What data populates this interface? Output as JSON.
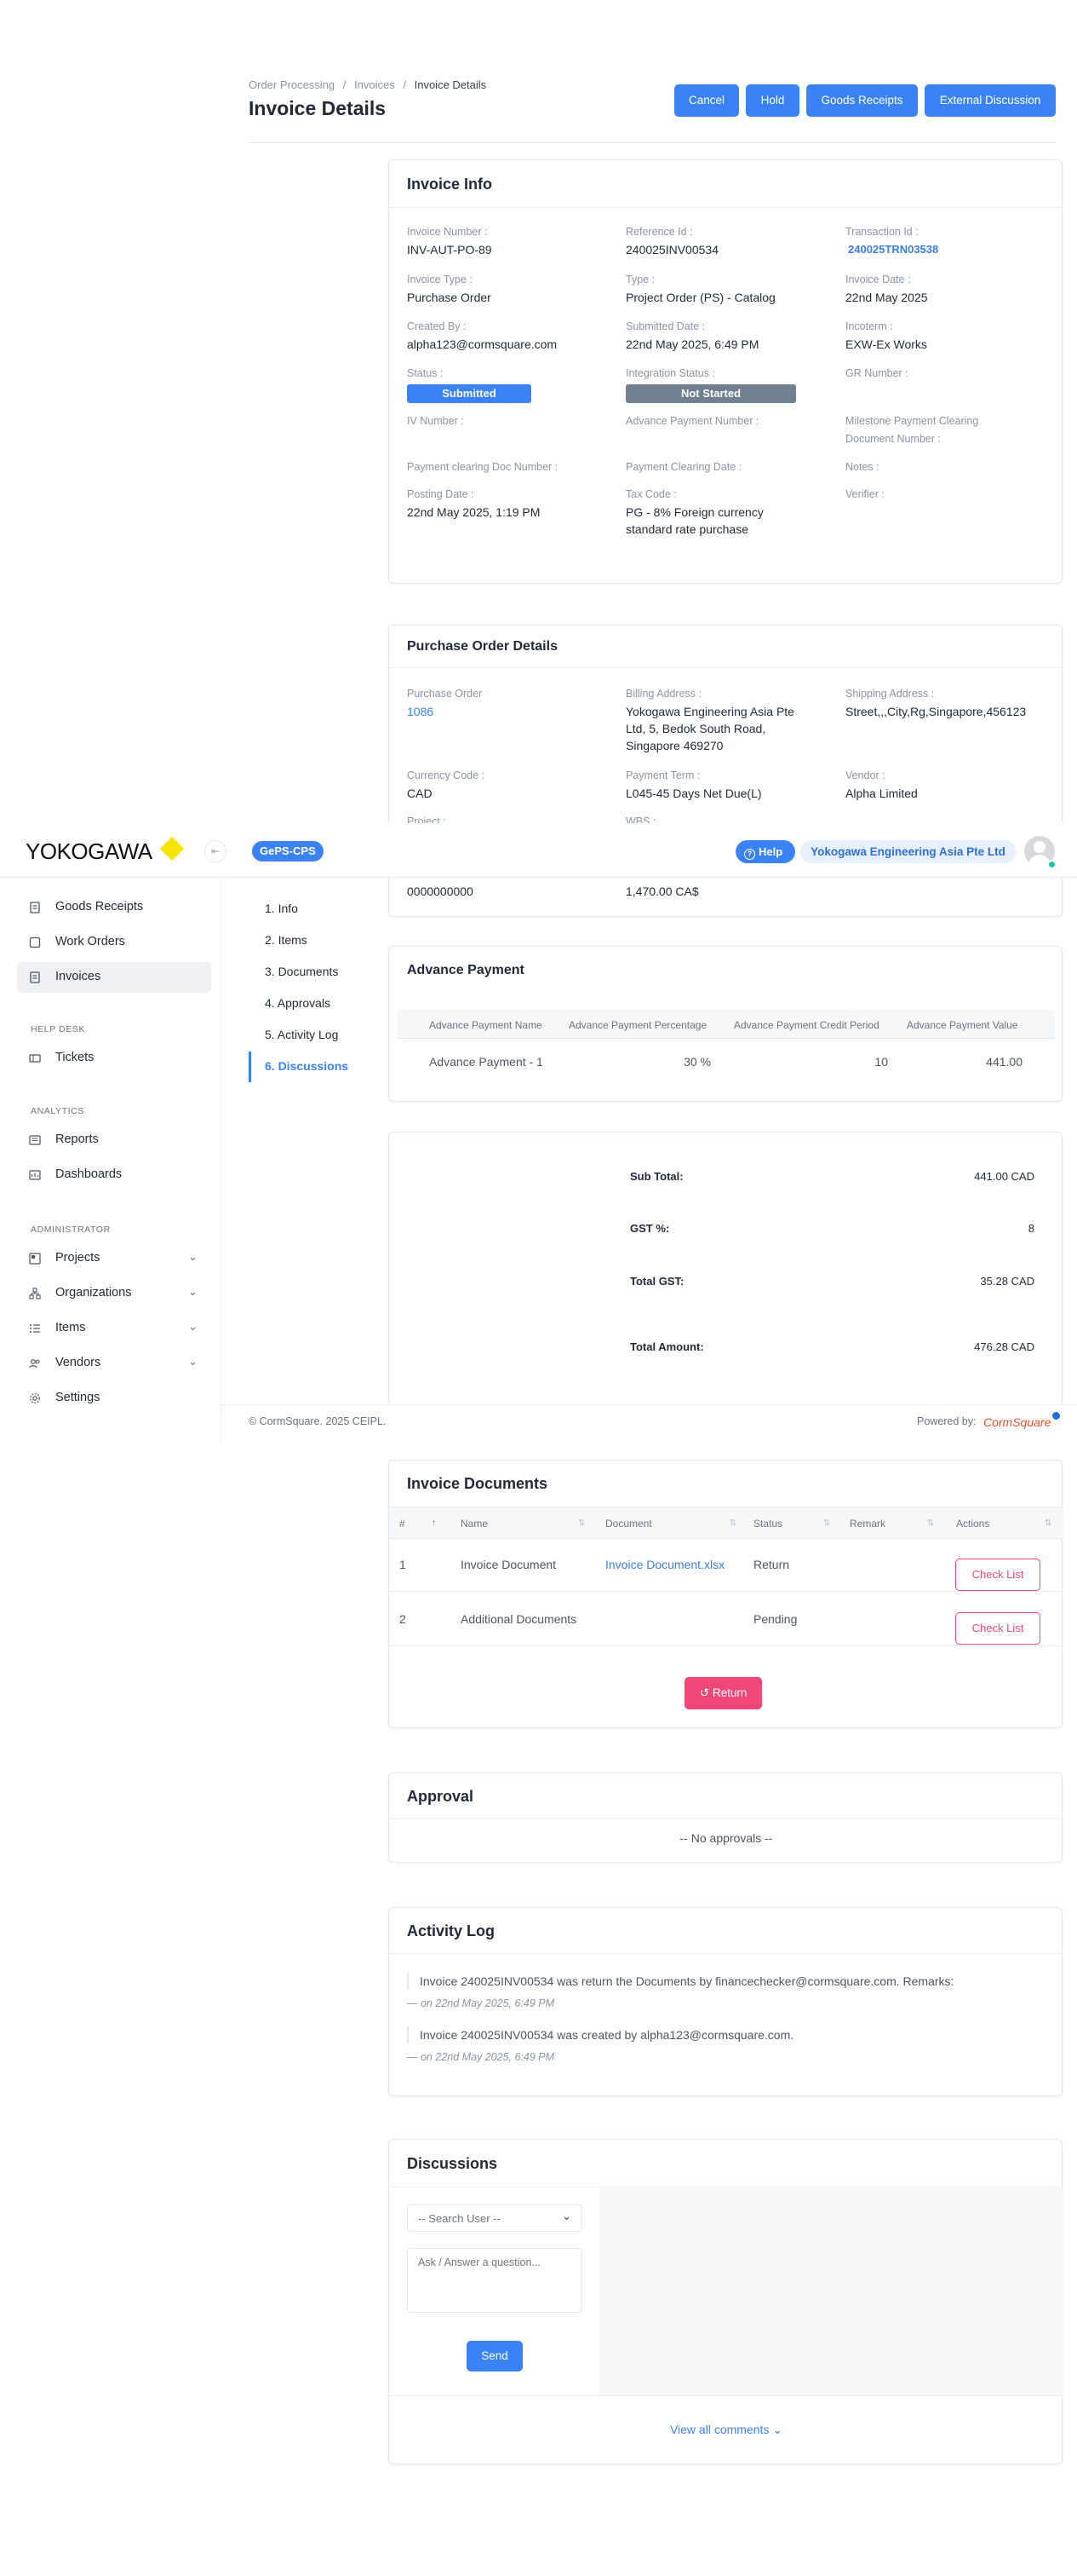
{
  "breadcrumb": [
    "Order Processing",
    "Invoices",
    "Invoice Details"
  ],
  "page_title": "Invoice Details",
  "actions": {
    "cancel": "Cancel",
    "hold": "Hold",
    "goods_receipts": "Goods Receipts",
    "external_discussion": "External Discussion"
  },
  "invoice_info": {
    "title": "Invoice Info",
    "invoice_number": {
      "label": "Invoice Number :",
      "value": "INV-AUT-PO-89"
    },
    "reference_id": {
      "label": "Reference Id :",
      "value": "240025INV00534"
    },
    "transaction_id": {
      "label": "Transaction Id :",
      "value": "240025TRN03538"
    },
    "invoice_type": {
      "label": "Invoice Type :",
      "value": "Purchase Order"
    },
    "type": {
      "label": "Type :",
      "value": "Project Order (PS) - Catalog"
    },
    "invoice_date": {
      "label": "Invoice Date :",
      "value": "22nd May 2025"
    },
    "created_by": {
      "label": "Created By :",
      "value": "alpha123@cormsquare.com"
    },
    "submitted_date": {
      "label": "Submitted Date :",
      "value": "22nd May 2025, 6:49 PM"
    },
    "incoterm": {
      "label": "Incoterm :",
      "value": "EXW-Ex Works"
    },
    "status": {
      "label": "Status :",
      "value": "Submitted"
    },
    "integration_status": {
      "label": "Integration Status :",
      "value": "Not Started"
    },
    "gr_number": {
      "label": "GR Number :"
    },
    "iv_number": {
      "label": "IV Number :"
    },
    "advance_payment_number": {
      "label": "Advance Payment Number :"
    },
    "milestone": {
      "label_1": "Milestone Payment Clearing",
      "label_2": "Document Number :"
    },
    "payment_clearing_doc": {
      "label": "Payment clearing Doc Number :"
    },
    "payment_clearing_date": {
      "label": "Payment Clearing Date :"
    },
    "notes": {
      "label": "Notes :"
    },
    "posting_date": {
      "label": "Posting Date :",
      "value": "22nd May 2025, 1:19 PM"
    },
    "tax_code": {
      "label": "Tax Code :",
      "value_1": "PG - 8% Foreign currency",
      "value_2": "standard rate purchase"
    },
    "verifier": {
      "label": "Verifier :"
    }
  },
  "po_details": {
    "title": "Purchase Order Details",
    "purchase_order": {
      "label": "Purchase Order",
      "value": "1086"
    },
    "billing_address": {
      "label": "Billing Address :",
      "line1": "Yokogawa Engineering Asia Pte",
      "line2": "Ltd, 5, Bedok South Road,",
      "line3": "Singapore 469270"
    },
    "shipping_address": {
      "label": "Shipping Address :",
      "value": "Street,,,City,Rg,Singapore,456123"
    },
    "currency_code": {
      "label": "Currency Code :",
      "value": "CAD"
    },
    "payment_term": {
      "label": "Payment Term :",
      "value": "L045-45 Days Net Due(L)"
    },
    "vendor": {
      "label": "Vendor :",
      "value": "Alpha Limited"
    },
    "project": {
      "label": "Project :"
    },
    "wbs": {
      "label": "WBS :"
    },
    "hidden_value_1": "0000000000",
    "hidden_value_2": "1,470.00 CA$"
  },
  "topbar": {
    "logo": "YOKOGAWA",
    "app_badge": "GePS-CPS",
    "help": "Help",
    "company": "Yokogawa Engineering Asia Pte Ltd",
    "collapse_icon": "sidebar-collapse-icon"
  },
  "sidebar": {
    "items_top": [
      {
        "label": "Goods Receipts",
        "icon": "document-icon"
      },
      {
        "label": "Work Orders",
        "icon": "square-icon"
      },
      {
        "label": "Invoices",
        "icon": "document-icon",
        "active": true
      }
    ],
    "help_desk": {
      "heading": "HELP DESK",
      "items": [
        {
          "label": "Tickets",
          "icon": "ticket-icon"
        }
      ]
    },
    "analytics": {
      "heading": "ANALYTICS",
      "items": [
        {
          "label": "Reports",
          "icon": "report-icon"
        },
        {
          "label": "Dashboards",
          "icon": "dashboard-icon"
        }
      ]
    },
    "administrator": {
      "heading": "ADMINISTRATOR",
      "items": [
        {
          "label": "Projects",
          "icon": "project-icon"
        },
        {
          "label": "Organizations",
          "icon": "organization-icon"
        },
        {
          "label": "Items",
          "icon": "list-icon"
        },
        {
          "label": "Vendors",
          "icon": "users-icon"
        },
        {
          "label": "Settings",
          "icon": "gear-icon"
        }
      ]
    }
  },
  "anchors": [
    "1. Info",
    "2. Items",
    "3. Documents",
    "4. Approvals",
    "5. Activity Log",
    "6. Discussions"
  ],
  "advance_payment": {
    "title": "Advance Payment",
    "columns": [
      "Advance Payment Name",
      "Advance Payment Percentage",
      "Advance Payment Credit Period",
      "Advance Payment Value"
    ],
    "rows": [
      {
        "name": "Advance Payment - 1",
        "percentage": "30 %",
        "credit_period": "10",
        "value": "441.00"
      }
    ]
  },
  "totals": {
    "sub_total": {
      "label": "Sub Total:",
      "value": "441.00 CAD"
    },
    "gst_percent": {
      "label": "GST %:",
      "value": "8"
    },
    "total_gst": {
      "label": "Total GST:",
      "value": "35.28 CAD"
    },
    "total_amount": {
      "label": "Total Amount:",
      "value": "476.28 CAD"
    }
  },
  "footer": {
    "copyright": "© CormSquare. 2025 CEIPL.",
    "powered_by": "Powered by:",
    "brand": "CormSquare"
  },
  "documents": {
    "title": "Invoice Documents",
    "columns": [
      "#",
      "Name",
      "Document",
      "Status",
      "Remark",
      "Actions"
    ],
    "rows": [
      {
        "num": "1",
        "name": "Invoice Document",
        "document": "Invoice Document.xlsx",
        "status": "Return",
        "remark": "",
        "action": "Check List"
      },
      {
        "num": "2",
        "name": "Additional Documents",
        "document": "",
        "status": "Pending",
        "remark": "",
        "action": "Check List"
      }
    ],
    "return_button": "Return"
  },
  "approval": {
    "title": "Approval",
    "empty": "-- No approvals --"
  },
  "activity_log": {
    "title": "Activity Log",
    "entries": [
      {
        "text": "Invoice 240025INV00534 was return the Documents by financechecker@cormsquare.com. Remarks:",
        "date": "22nd May 2025, 6:49 PM"
      },
      {
        "text": "Invoice 240025INV00534 was created by alpha123@cormsquare.com.",
        "date": "22nd May 2025, 6:49 PM"
      }
    ],
    "date_prefix": "— on"
  },
  "discussions": {
    "title": "Discussions",
    "search_placeholder": "-- Search User --",
    "question_placeholder": "Ask / Answer a question...",
    "send": "Send",
    "view_all": "View all comments"
  },
  "colors": {
    "primary": "#3b82f6",
    "status_submitted": "#3b82f6",
    "status_not_started": "#708090",
    "danger": "#ef4778",
    "active_item": "#eef0f3"
  }
}
